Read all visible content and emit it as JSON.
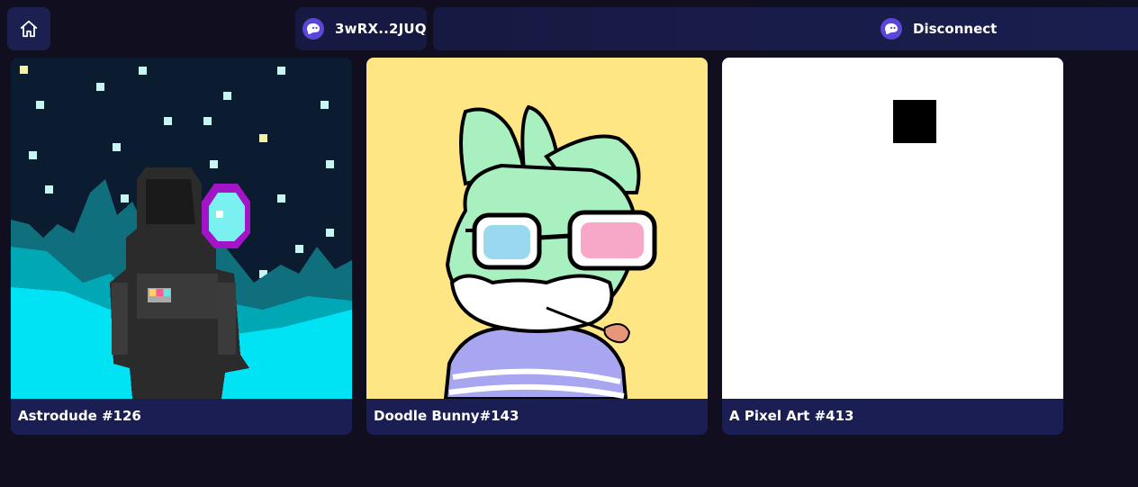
{
  "nav": {
    "home_icon": "home-icon"
  },
  "wallet": {
    "address": "3wRX..2JUQ",
    "icon": "phantom-ghost-icon",
    "accent": "#5a47d8"
  },
  "disconnect": {
    "label": "Disconnect",
    "icon": "phantom-ghost-icon"
  },
  "nfts": [
    {
      "name": "Astrodude #126"
    },
    {
      "name": "Doodle Bunny#143"
    },
    {
      "name": "A Pixel Art #413"
    }
  ],
  "colors": {
    "background": "#110e1f",
    "card": "#1a1e52",
    "header": "#161a42"
  }
}
